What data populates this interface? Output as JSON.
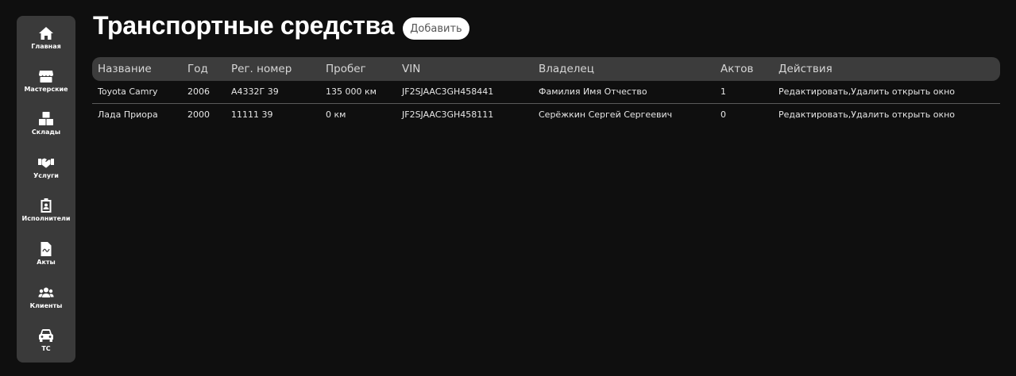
{
  "page": {
    "title": "Транспортные средства",
    "add_button_label": "Добавить"
  },
  "sidebar": {
    "items": [
      {
        "label": "Главная",
        "icon": "home-icon"
      },
      {
        "label": "Мастерские",
        "icon": "store-icon"
      },
      {
        "label": "Склады",
        "icon": "boxes-icon"
      },
      {
        "label": "Услуги",
        "icon": "handshake-icon"
      },
      {
        "label": "Исполнители",
        "icon": "id-badge-icon"
      },
      {
        "label": "Акты",
        "icon": "document-icon"
      },
      {
        "label": "Клиенты",
        "icon": "users-icon"
      },
      {
        "label": "ТС",
        "icon": "car-icon"
      }
    ]
  },
  "table": {
    "columns": [
      "Название",
      "Год",
      "Рег. номер",
      "Пробег",
      "VIN",
      "Владелец",
      "Актов",
      "Действия"
    ],
    "rows": [
      {
        "name": "Toyota Camry",
        "year": "2006",
        "reg_number": "А4332Г 39",
        "mileage": "135 000 км",
        "vin": "JF2SJAAC3GH458441",
        "owner": "Фамилия Имя Отчество",
        "acts": "1",
        "actions": "Редактировать,Удалить открыть окно"
      },
      {
        "name": "Лада Приора",
        "year": "2000",
        "reg_number": "11111 39",
        "mileage": "0 км",
        "vin": "JF2SJAAC3GH458111",
        "owner": "Серёжкин Сергей Сергеевич",
        "acts": "0",
        "actions": "Редактировать,Удалить открыть окно"
      }
    ]
  },
  "colors": {
    "background": "#0f0f0f",
    "sidebar": "#3a3a3a",
    "table_header": "#3c3c3c",
    "text": "#e6e6e6"
  }
}
